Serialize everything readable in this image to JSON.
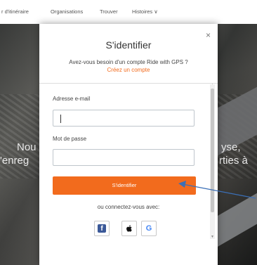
{
  "nav": {
    "items": [
      "r d'itinéraire",
      "Organisations",
      "Trouver",
      "Histoires ∨"
    ]
  },
  "background": {
    "text_left_1": "Nou",
    "text_left_2": "'enreg",
    "text_right_1": "yse,",
    "text_right_2": "rties à"
  },
  "modal": {
    "title": "S'identifier",
    "subtitle": "Avez-vous besoin d'un compte Ride with GPS ?",
    "create_link": "Créez un compte",
    "close_glyph": "×",
    "email": {
      "label": "Adresse e-mail",
      "value": "",
      "placeholder": ""
    },
    "password": {
      "label": "Mot de passe",
      "value": "",
      "placeholder": ""
    },
    "submit_label": "S'identifier",
    "or_text": "ou connectez-vous avec:",
    "social": [
      {
        "name": "facebook-icon",
        "glyph": "f"
      },
      {
        "name": "apple-icon",
        "glyph": ""
      },
      {
        "name": "google-icon",
        "glyph": "G"
      }
    ]
  },
  "annotation": {
    "arrow_color": "#3b6fb6",
    "accent": "#f26b1d"
  }
}
